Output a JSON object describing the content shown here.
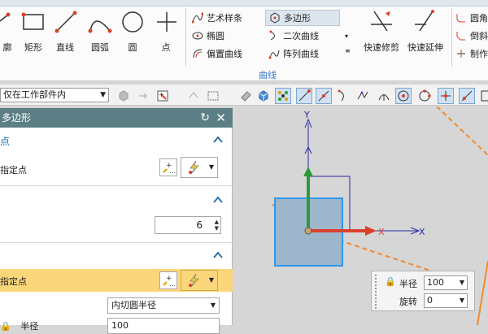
{
  "ribbon": {
    "big_buttons": [
      "廓",
      "矩形",
      "直线",
      "圆弧",
      "圆",
      "点"
    ],
    "small_left": [
      "艺术样条",
      "椭圆",
      "偏置曲线"
    ],
    "small_right": [
      "多边形",
      "二次曲线",
      "阵列曲线"
    ],
    "edit_buttons": [
      "快速修剪",
      "快速延伸"
    ],
    "far_right": [
      "圆角",
      "倒斜",
      "制作"
    ],
    "group_label": "曲线"
  },
  "toolbar": {
    "filter_value": "仅在工作部件内"
  },
  "panel": {
    "title": "多边形",
    "section_center": "点",
    "specify_point_label": "指定点",
    "sides_value": "6",
    "second_point_label": "指定点",
    "size_mode": "内切圆半径",
    "radius_label": "半径",
    "radius_value": "100"
  },
  "hud": {
    "radius_label": "半径",
    "radius_value": "100",
    "rotate_label": "旋转",
    "rotate_value": "0"
  },
  "axes": {
    "x": "X",
    "y": "Y"
  }
}
